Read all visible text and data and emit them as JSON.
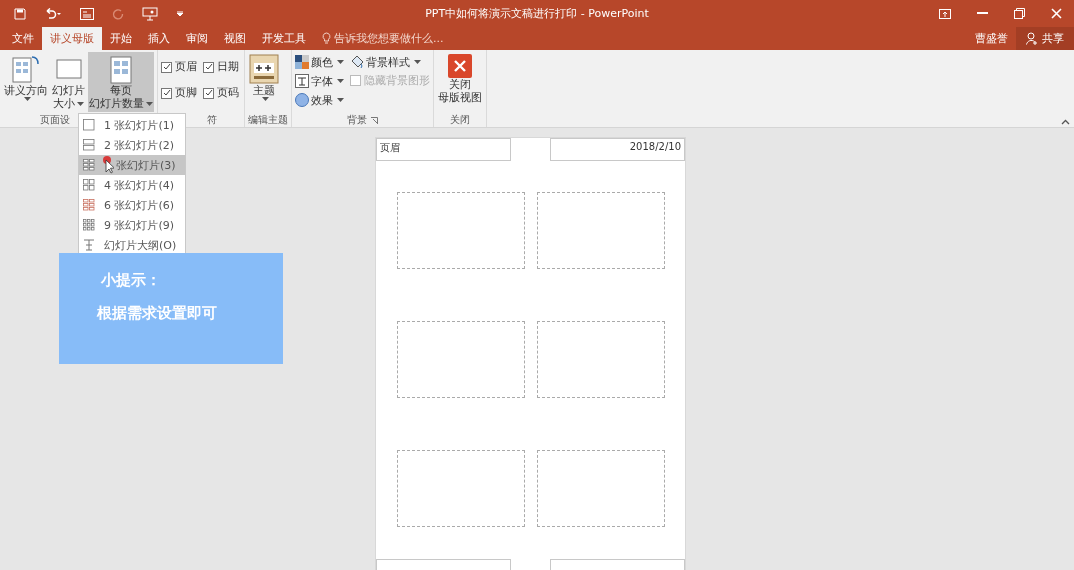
{
  "window": {
    "title": "PPT中如何将演示文稿进行打印 - PowerPoint",
    "user": "曹盛誉",
    "share": "共享"
  },
  "tabs": [
    {
      "label": "文件",
      "selected": false
    },
    {
      "label": "讲义母版",
      "selected": true
    },
    {
      "label": "开始",
      "selected": false
    },
    {
      "label": "插入",
      "selected": false
    },
    {
      "label": "审阅",
      "selected": false
    },
    {
      "label": "视图",
      "selected": false
    },
    {
      "label": "开发工具",
      "selected": false
    }
  ],
  "tell_me": {
    "placeholder": "告诉我您想要做什么..."
  },
  "ribbon": {
    "groups": [
      {
        "label": "页面设",
        "kind": "big",
        "items": [
          {
            "lines": [
              "讲义方向"
            ],
            "dropdown": true,
            "pressed": false
          },
          {
            "lines": [
              "幻灯片",
              "大小"
            ],
            "dropdown": true,
            "pressed": false
          },
          {
            "lines": [
              "每页",
              "幻灯片数量"
            ],
            "dropdown": true,
            "pressed": true
          }
        ]
      },
      {
        "label": "符",
        "kind": "checks",
        "items": [
          {
            "label": "页眉",
            "checked": true
          },
          {
            "label": "日期",
            "checked": true
          },
          {
            "label": "页脚",
            "checked": true
          },
          {
            "label": "页码",
            "checked": true
          }
        ]
      },
      {
        "label": "编辑主题",
        "kind": "big",
        "items": [
          {
            "lines": [
              "主题"
            ],
            "dropdown": true,
            "pressed": false
          }
        ]
      },
      {
        "label": "背景",
        "kind": "background",
        "items": [
          {
            "label": "颜色"
          },
          {
            "label": "字体"
          },
          {
            "label": "效果"
          },
          {
            "label": "背景样式"
          }
        ],
        "hide_graphics": {
          "label": "隐藏背景图形",
          "checked": false,
          "disabled": true
        }
      },
      {
        "label": "关闭",
        "kind": "close",
        "items": [
          {
            "lines": [
              "关闭",
              "母版视图"
            ],
            "dropdown": false,
            "pressed": false
          }
        ]
      }
    ]
  },
  "dropdown": {
    "items": [
      {
        "label": "1 张幻灯片(1)",
        "selected": false
      },
      {
        "label": "2 张幻灯片(2)",
        "selected": false
      },
      {
        "label": "张幻灯片(3)",
        "selected": true
      },
      {
        "label": "4 张幻灯片(4)",
        "selected": false
      },
      {
        "label": "6 张幻灯片(6)",
        "selected": false
      },
      {
        "label": "9 张幻灯片(9)",
        "selected": false
      },
      {
        "label": "幻灯片大纲(O)",
        "selected": false
      }
    ]
  },
  "tip": {
    "title": "小提示：",
    "text": "根据需求设置即可"
  },
  "handout": {
    "header": "页眉",
    "date": "2018/2/10"
  }
}
